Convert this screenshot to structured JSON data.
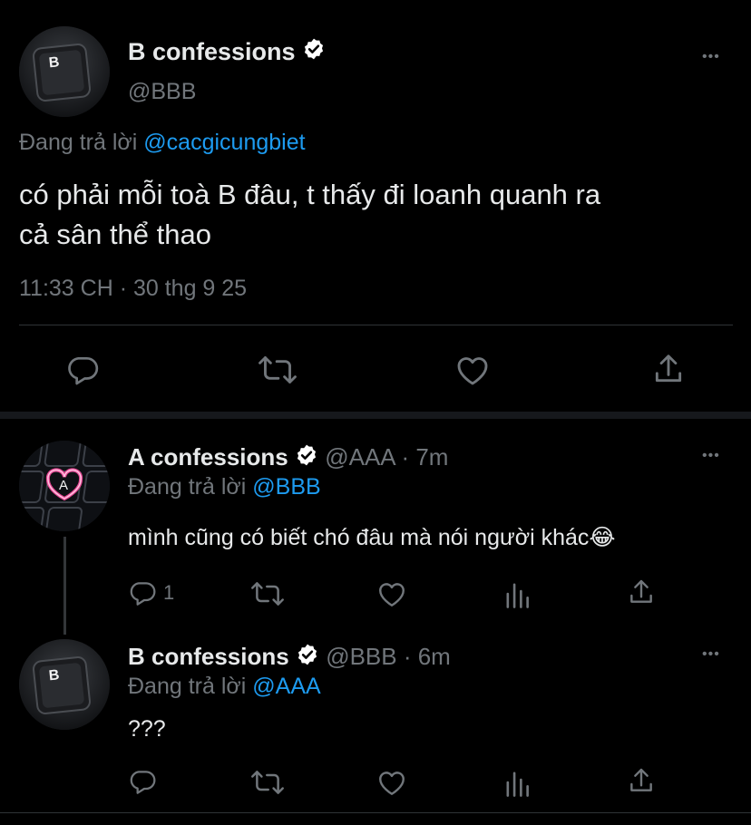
{
  "main_tweet": {
    "display_name": "B confessions",
    "handle": "@BBB",
    "replying_label": "Đang trả lời",
    "replying_to": "@cacgicungbiet",
    "text_line1": "có phải mỗi toà B đâu, t thấy đi loanh quanh ra",
    "text_line2": "cả sân thể thao",
    "timestamp": "11:33 CH · 30 thg 9 25",
    "avatar_key": "B"
  },
  "replies": [
    {
      "display_name": "A confessions",
      "handle": "@AAA",
      "time": "· 7m",
      "replying_label": "Đang trả lời",
      "replying_to": "@BBB",
      "text": "mình cũng có biết chó đâu mà nói người khác😂",
      "reply_count": "1",
      "avatar_key": "A"
    },
    {
      "display_name": "B confessions",
      "handle": "@BBB",
      "time": "· 6m",
      "replying_label": "Đang trả lời",
      "replying_to": "@AAA",
      "text": "???",
      "avatar_key": "B"
    }
  ],
  "more_glyph": "•••",
  "colors": {
    "background": "#000000",
    "text": "#e7e9ea",
    "muted": "#71767b",
    "link": "#1d9bf0",
    "verified": "#ffffff",
    "divider": "#2f3336",
    "heart_glow": "#ff4fa3"
  },
  "icons": [
    "reply-icon",
    "retweet-icon",
    "like-icon",
    "share-icon",
    "analytics-icon",
    "more-icon",
    "verified-badge-icon"
  ]
}
